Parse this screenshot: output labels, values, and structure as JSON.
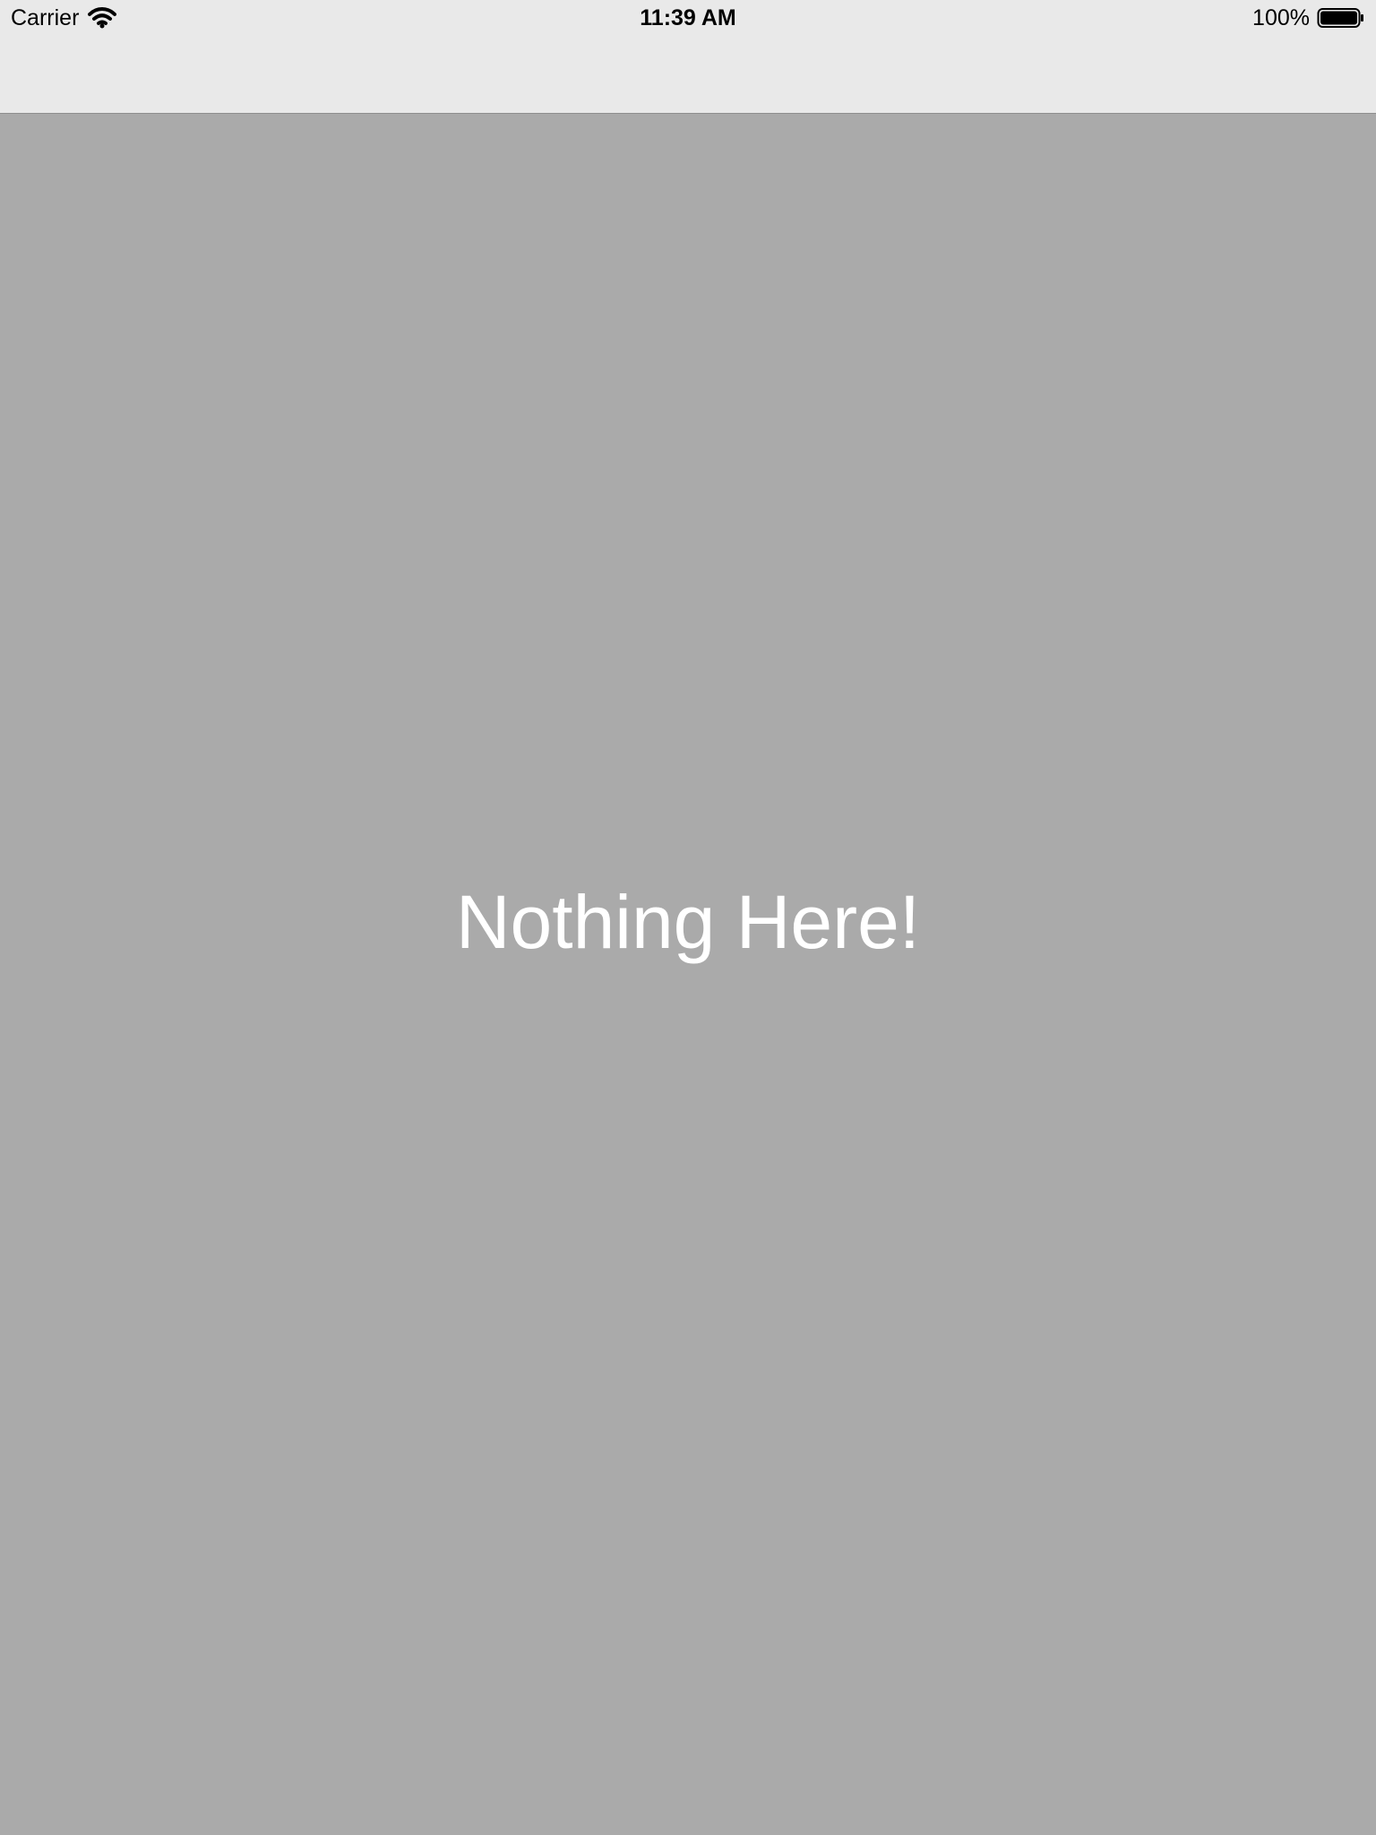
{
  "status_bar": {
    "carrier": "Carrier",
    "time": "11:39 AM",
    "battery_percent_text": "100%",
    "battery_level": 1.0,
    "icons": {
      "wifi": "wifi-icon",
      "battery": "battery-icon"
    }
  },
  "main": {
    "message": "Nothing Here!"
  },
  "colors": {
    "topbar_background": "#e9e9e9",
    "content_background": "#aaaaaa",
    "message_text": "#ffffff"
  }
}
